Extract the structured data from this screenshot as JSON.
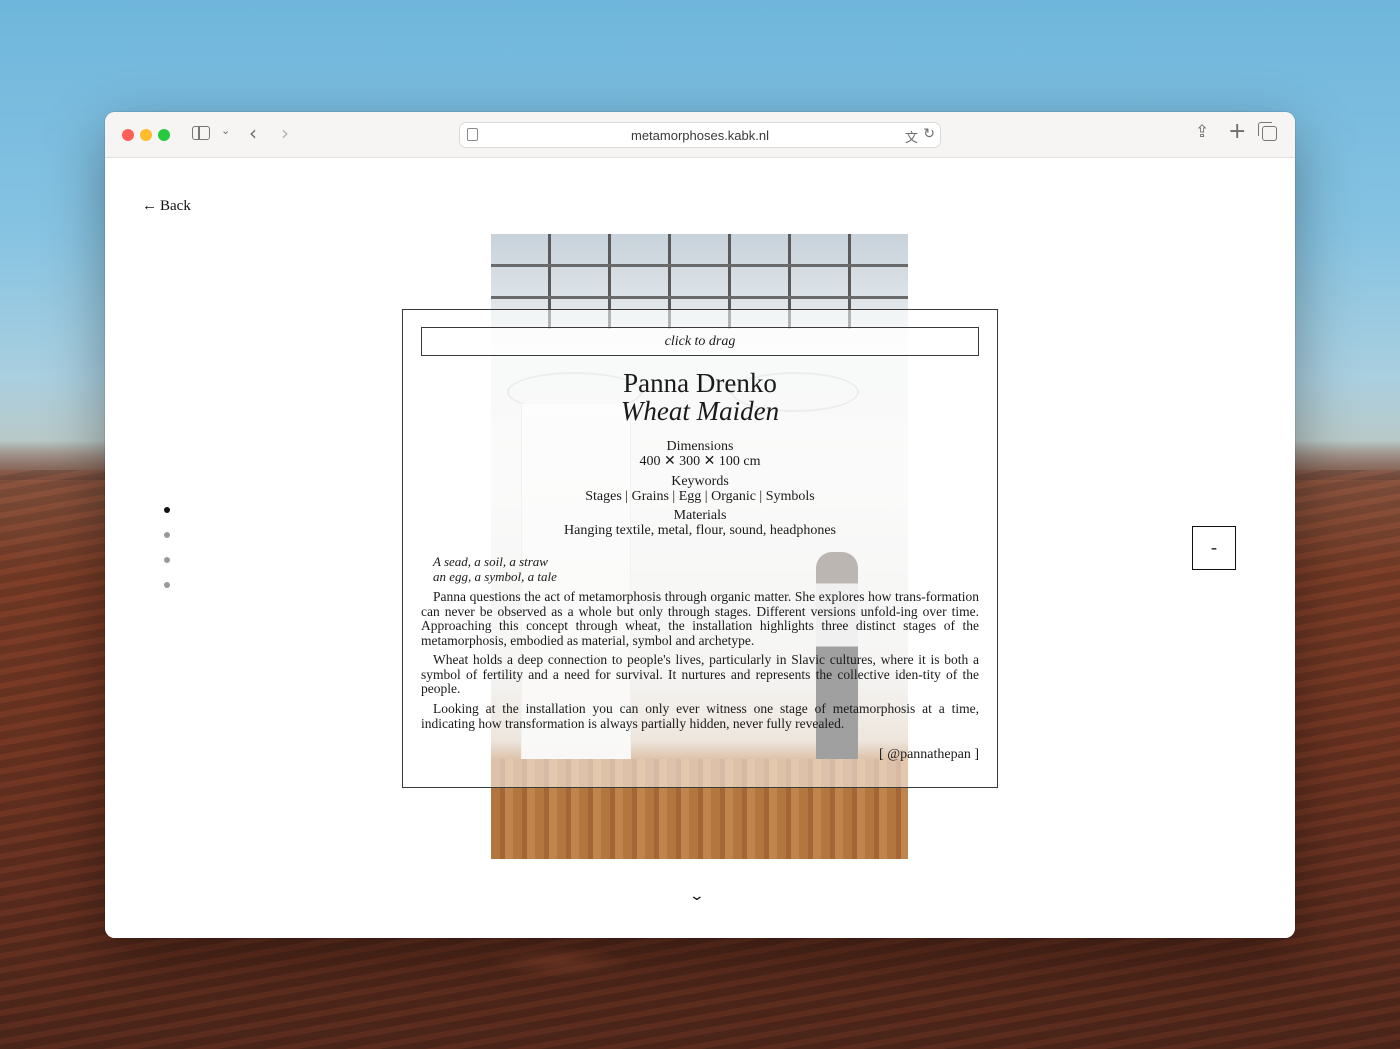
{
  "browser": {
    "url": "metamorphoses.kabk.nl"
  },
  "page": {
    "back_label": "Back",
    "back_arrow": "←",
    "drag_hint": "click to drag",
    "artist": "Panna Drenko",
    "title": "Wheat Maiden",
    "dimensions": {
      "label": "Dimensions",
      "value": "400 ✕ 300 ✕ 100 cm"
    },
    "keywords": {
      "label": "Keywords",
      "value": "Stages | Grains | Egg | Organic | Symbols"
    },
    "materials": {
      "label": "Materials",
      "value": "Hanging textile, metal, flour, sound, headphones"
    },
    "poem": [
      "A sead, a soil, a straw",
      "an egg, a symbol, a tale"
    ],
    "paragraphs": [
      "Panna questions the act of metamorphosis through organic matter. She explores how trans-formation can never be observed as a whole but only through stages. Different versions unfold-ing over time. Approaching this concept through wheat, the installation highlights three distinct stages of the metamorphosis, embodied as material, symbol and archetype.",
      "Wheat holds a deep connection to people's lives, particularly in Slavic cultures, where it is both a symbol of fertility and a need for survival. It nurtures and represents the collective iden-tity of the people.",
      "Looking at the installation you can only ever witness one stage of metamorphosis at a time, indicating how transformation is always partially hidden, never fully revealed."
    ],
    "credit": "[ @pannathepan ]",
    "minus_label": "-",
    "pager": {
      "count": 4,
      "active": 1
    }
  }
}
